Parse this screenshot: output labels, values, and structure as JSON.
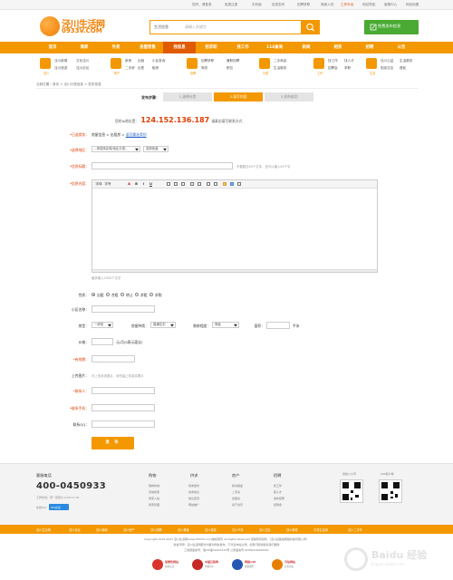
{
  "topbar": {
    "welcome": "您好，请登录",
    "register": "免费注册",
    "links": [
      "我的",
      "登录",
      "免费注册",
      "手机版",
      "信息发布",
      "招聘求职",
      "商家入驻"
    ],
    "highlight": "工作平台",
    "extra": [
      "网站导航",
      "客服中心",
      "网站地图"
    ]
  },
  "logo": {
    "line1": "泾川生活网",
    "line2": "0933V.COM"
  },
  "search": {
    "category": "生活信息",
    "placeholder": "请输入关键字"
  },
  "publish_button": "免费发布信息",
  "nav": {
    "items": [
      "首页",
      "商家",
      "外卖",
      "房屋租售",
      "找信息",
      "招求职",
      "找工作",
      "114查询",
      "新闻",
      "相亲",
      "招聘",
      "公告"
    ],
    "active_index": 4
  },
  "categories": [
    {
      "name": "泾川",
      "links": [
        "泾川新闻",
        "文化泾川",
        "泾川旅游",
        "泾川论坛"
      ]
    },
    {
      "name": "房产",
      "links": [
        "新房",
        "二手房",
        "出租",
        "出售",
        "小区查询",
        "租房"
      ]
    },
    {
      "name": "招聘",
      "links": [
        "招聘求职",
        "兼职招聘",
        "简历",
        "职位"
      ]
    },
    {
      "name": "分类",
      "links": [
        "二手商品",
        "生活服务",
        "家政",
        "教育"
      ]
    },
    {
      "name": "工作",
      "links": [
        "找工作",
        "找人才",
        "招聘会",
        "求职"
      ]
    },
    {
      "name": "生活",
      "links": [
        "泾川公益",
        "生活服务",
        "相亲交友",
        "便民"
      ]
    }
  ],
  "breadcrumb": "当前位置：首页 > 泾川分类信息 > 发布信息",
  "steps": {
    "label": "发布步骤：",
    "items": [
      "1.选择分类",
      "2.填写内容",
      "3.发布成功"
    ],
    "active_index": 1
  },
  "ip": {
    "prefix": "您的Ip地址是：",
    "value": "124.152.136.187",
    "suffix": "请真实填写联系方式"
  },
  "form": {
    "category": {
      "label": "*已选类别：",
      "value": "房屋信息 > 出租房 >",
      "change": "返回重选类别"
    },
    "region": {
      "label": "*选择地区：",
      "select1": "--请选择区域/地区分类--",
      "select2": "选择街道"
    },
    "title": {
      "label": "*信息标题：",
      "hint": "不要超过40个文本，还可以输入40个字"
    },
    "content": {
      "label": "*信息内容：",
      "hint": "最多输入2000个文字"
    },
    "editor_tools": [
      "字体",
      "字号",
      "A",
      "B",
      "I",
      "U"
    ],
    "nature": {
      "label": "性质：",
      "options": [
        "出租",
        "合租",
        "转让",
        "求租",
        "求购"
      ],
      "selected_index": 0
    },
    "community": {
      "label": "小区名称："
    },
    "house": {
      "type_label": "房型：",
      "type_value": "一房室",
      "kind_label": "房屋种类：",
      "kind_value": "普通住宅",
      "decor_label": "装修程度：",
      "decor_value": "简装",
      "area_label": "面积：",
      "area_unit": "平米"
    },
    "price": {
      "label": "价格：",
      "unit": "元/月(0表示面议)"
    },
    "valid": {
      "label": "*有效期："
    },
    "photos": {
      "label": "上传图片：",
      "hint": "可上传多张图片，请尽量上传真实照片"
    },
    "contact": {
      "label": "*联系人："
    },
    "phone": {
      "label": "*联系手机："
    },
    "qq": {
      "label": "联系QQ："
    },
    "submit": "发 布"
  },
  "footer": {
    "hotline_title": "客服电话",
    "hotline": "400-0450933",
    "hours": "工作时间：周一至周六 9:00-17:30",
    "online_label": "在线QQ：",
    "online_badge": "QQ交谈",
    "columns": [
      {
        "title": "购物",
        "links": [
          "购物商城",
          "同城商家",
          "商家入驻",
          "商家管理"
        ]
      },
      {
        "title": "供求",
        "links": [
          "供求发布",
          "供求信息",
          "信息置顶",
          "网站推广"
        ]
      },
      {
        "title": "房产",
        "links": [
          "新房楼盘",
          "二手房",
          "出租房",
          "房产资讯"
        ]
      },
      {
        "title": "招聘",
        "links": [
          "找工作",
          "招人才",
          "发布招聘",
          "招聘会"
        ]
      }
    ],
    "qr1_label": "微信公众号",
    "qr2_label": "APP客户端"
  },
  "friend_links": [
    "泾川生活网",
    "泾川论坛",
    "泾川新闻",
    "泾川房产",
    "泾川招聘",
    "泾川美食",
    "泾川旅游",
    "泾川汽车",
    "泾川交友",
    "泾川教育",
    "平凉生活网",
    "泾川二手车"
  ],
  "copyright": [
    "Copyright 2015-2023 泾川生活网(www.0933V.com)版权所有 All Rights Reserved 保留所有权利 （泾川县盈信网络科技有限公司）",
    "免责声明：泾川生活网部分内容为网友发布，不代表本站立场，如有问题请联系我们删除",
    "工信部备案号：陇ICP备16003133号    公安备案号 62082102000001"
  ],
  "badges": [
    {
      "title": "经营性网站",
      "sub": "备案信息",
      "color": "#d9352b"
    },
    {
      "title": "中国互联网",
      "sub": "举报中心",
      "color": "#c62828"
    },
    {
      "title": "网络110",
      "sub": "报警服务",
      "color": "#2457b3"
    },
    {
      "title": "可信网站",
      "sub": "身份验证",
      "color": "#e67e00"
    }
  ],
  "watermark": {
    "text": "Baidu 经验",
    "url": "jingyan.baidu.com"
  }
}
